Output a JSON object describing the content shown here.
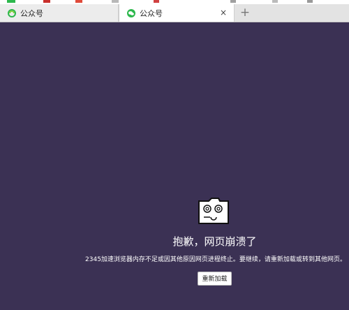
{
  "tabs": [
    {
      "title": "公众号",
      "icon": "green-swirl-icon",
      "active": false
    },
    {
      "title": "公众号",
      "icon": "wechat-icon",
      "active": true,
      "close_label": "×"
    }
  ],
  "new_tab_label": "+",
  "crash": {
    "icon": "dizzy-folder-icon",
    "title": "抱歉，网页崩溃了",
    "message": "2345加速浏览器内存不足或因其他原因网页进程终止。要继续，请重新加载或转到其他网页。",
    "reload_button": "重新加载"
  },
  "colors": {
    "page_background": "#3b3154",
    "tab_bar": "#e3e3e3",
    "active_tab": "#ffffff",
    "accent_green": "#2db84d"
  }
}
